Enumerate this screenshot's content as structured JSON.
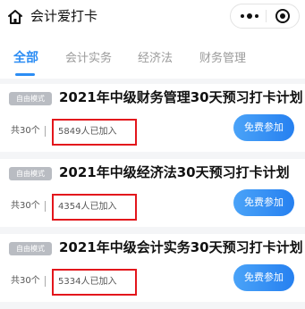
{
  "header": {
    "title": "会计爱打卡",
    "icons": [
      "home-icon",
      "more-icon",
      "target-icon"
    ]
  },
  "tabs": [
    {
      "label": "全部",
      "active": true
    },
    {
      "label": "会计实务",
      "active": false
    },
    {
      "label": "经济法",
      "active": false
    },
    {
      "label": "财务管理",
      "active": false
    }
  ],
  "plans": [
    {
      "badge": "自由模式",
      "title": "2021年中级财务管理30天预习打卡计划",
      "count": "共30个",
      "joined": "5849人已加入",
      "button": "免费参加"
    },
    {
      "badge": "自由模式",
      "title": "2021年中级经济法30天预习打卡计划",
      "count": "共30个",
      "joined": "4354人已加入",
      "button": "免费参加"
    },
    {
      "badge": "自由模式",
      "title": "2021年中级会计实务30天预习打卡计划",
      "count": "共30个",
      "joined": "5334人已加入",
      "button": "免费参加"
    }
  ],
  "colors": {
    "accent": "#2c8df4",
    "highlight": "#e3161c",
    "badge": "#b9bcc2"
  }
}
